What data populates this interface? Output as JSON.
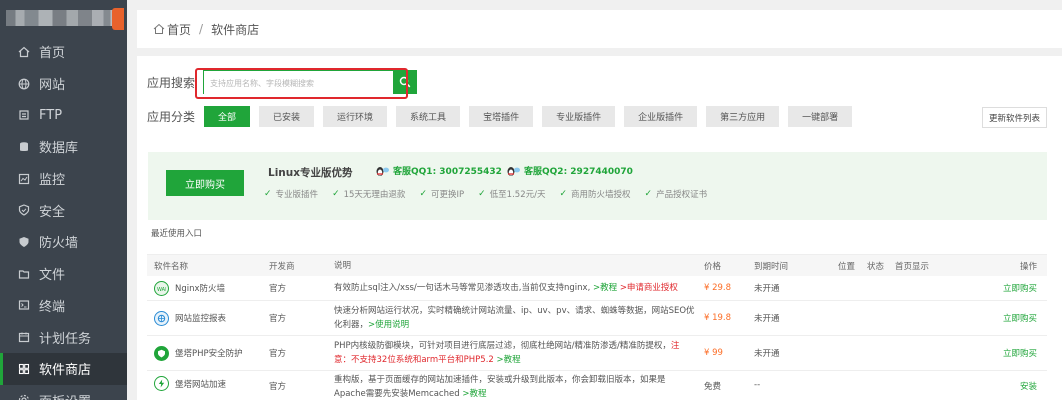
{
  "sidebar": {
    "items": [
      {
        "label": "首页",
        "icon": "home-icon"
      },
      {
        "label": "网站",
        "icon": "globe-icon"
      },
      {
        "label": "FTP",
        "icon": "ftp-icon"
      },
      {
        "label": "数据库",
        "icon": "database-icon"
      },
      {
        "label": "监控",
        "icon": "monitor-icon"
      },
      {
        "label": "安全",
        "icon": "shield-icon"
      },
      {
        "label": "防火墙",
        "icon": "firewall-icon"
      },
      {
        "label": "文件",
        "icon": "folder-icon"
      },
      {
        "label": "终端",
        "icon": "terminal-icon"
      },
      {
        "label": "计划任务",
        "icon": "calendar-icon"
      },
      {
        "label": "软件商店",
        "icon": "store-icon",
        "active": true
      },
      {
        "label": "面板设置",
        "icon": "settings-icon"
      }
    ]
  },
  "breadcrumb": {
    "home": "首页",
    "sep": "/",
    "current": "软件商店"
  },
  "search": {
    "label": "应用搜索",
    "placeholder": "支持应用名称、字段模糊搜索"
  },
  "category": {
    "label": "应用分类",
    "items": [
      "全部",
      "已安装",
      "运行环境",
      "系统工具",
      "宝塔插件",
      "专业版插件",
      "企业版插件",
      "第三方应用",
      "一键部署"
    ],
    "update_label": "更新软件列表"
  },
  "promo": {
    "buy_label": "立即购买",
    "title": "Linux专业版优势",
    "qq1": "客服QQ1: 3007255432",
    "qq2": "客服QQ2: 2927440070",
    "features": [
      "专业版插件",
      "15天无理由退款",
      "可更换IP",
      "低至1.52元/天",
      "商用防火墙授权",
      "产品授权证书"
    ]
  },
  "recent_label": "最近使用入口",
  "table": {
    "headers": {
      "name": "软件名称",
      "dev": "开发商",
      "desc": "说明",
      "price": "价格",
      "expire": "到期时间",
      "pos": "位置",
      "status": "状态",
      "home": "首页显示",
      "op": "操作"
    },
    "rows": [
      {
        "name": "Nginx防火墙",
        "dev": "官方",
        "desc1": "有效防止sql注入/xss/一句话木马等常见渗透攻击,当前仅支持nginx, ",
        "desc_link1": ">教程",
        "desc_link2": ">申请商业授权",
        "price": "¥ 29.8",
        "expire": "未开通",
        "op": "立即购买"
      },
      {
        "name": "网站监控报表",
        "dev": "官方",
        "desc1": "快速分析网站运行状况，实时精确统计网站流量、ip、uv、pv、请求、蜘蛛等数据，网站SEO优化利器，",
        "desc_link1": ">使用说明",
        "price": "¥ 19.8",
        "expire": "未开通",
        "op": "立即购买"
      },
      {
        "name": "堡塔PHP安全防护",
        "dev": "官方",
        "desc1": "PHP内核级防御模块，可针对项目进行底层过滤，彻底杜绝网站/精准防渗透/精准防提权，",
        "desc_red": "注意：不支持32位系统和arm平台和PHP5.2",
        "desc_link1": ">教程",
        "price": "¥ 99",
        "expire": "未开通",
        "op": "立即购买"
      },
      {
        "name": "堡塔网站加速",
        "dev": "官方",
        "desc1": "重构版，基于页面缓存的网站加速插件，安装或升级到此版本，你会卸载旧版本，如果是Apache需要先安装Memcached ",
        "desc_link1": ">教程",
        "price": "免费",
        "expire": "--",
        "op": "安装"
      }
    ]
  },
  "colors": {
    "accent": "#20a53a",
    "sidebar": "#3c444d",
    "highlight_frame": "#e0282d",
    "price": "#fc6d26"
  }
}
